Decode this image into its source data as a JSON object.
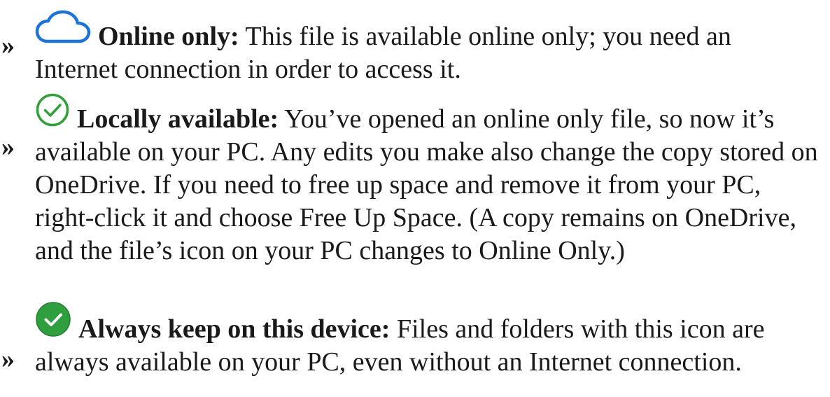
{
  "items": [
    {
      "bullet": "»",
      "icon": "cloud-outline-icon",
      "term": "Online only:",
      "description": "This file is available online only; you need an Internet connection in order to access it."
    },
    {
      "bullet": "»",
      "icon": "check-circle-outline-icon",
      "term": "Locally available:",
      "description": "You’ve opened an online only file, so now it’s available on your PC. Any edits you make also change the copy stored on OneDrive. If you need to free up space and remove it from your PC, right-click it and choose Free Up Space. (A copy remains on OneDrive, and the file’s icon on your PC changes to Online Only.)"
    },
    {
      "bullet": "»",
      "icon": "check-circle-filled-icon",
      "term": "Always keep on this device:",
      "description": "Files and folders with this icon are always available on your PC, even without an Internet connection."
    }
  ],
  "colors": {
    "cloud": "#1e74d6",
    "check_outline": "#31a03a",
    "check_filled": "#2e9e3e"
  }
}
